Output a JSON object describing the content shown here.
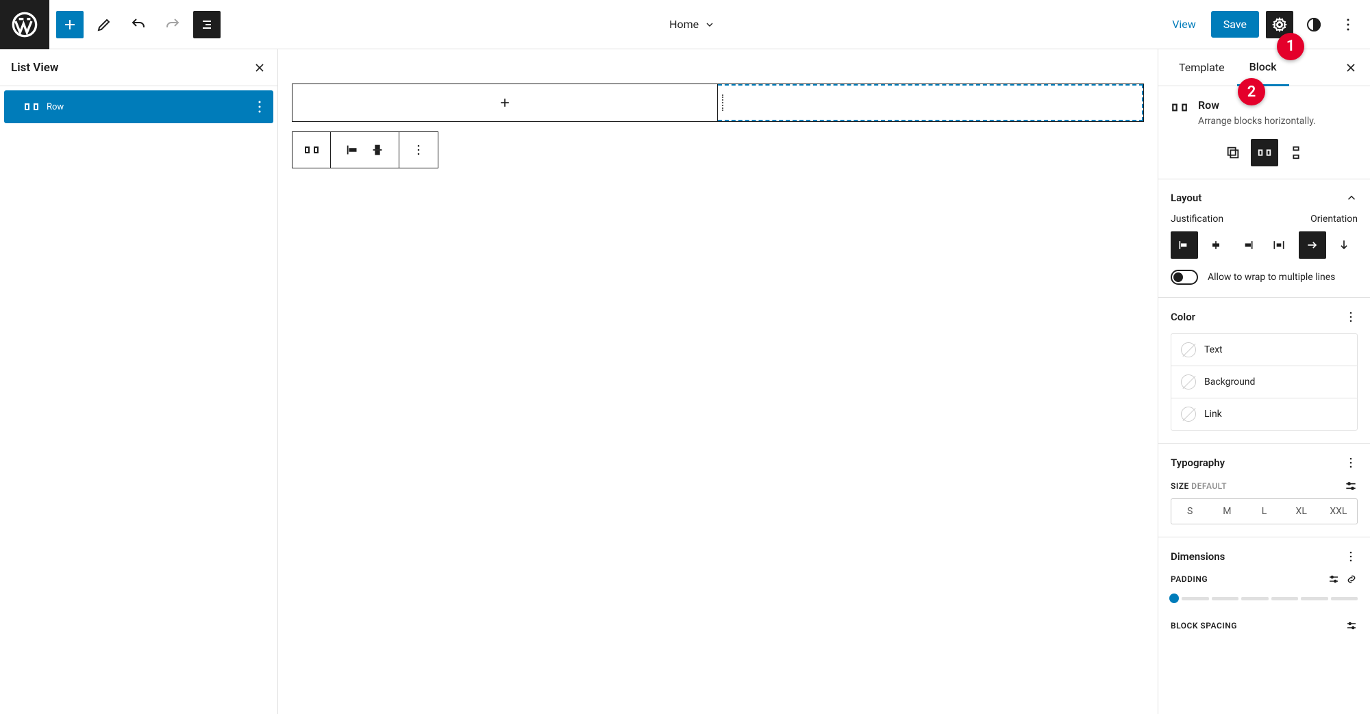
{
  "header": {
    "page_title": "Home",
    "view_label": "View",
    "save_label": "Save"
  },
  "annotations": {
    "badge1": "1",
    "badge2": "2"
  },
  "list_view": {
    "title": "List View",
    "items": [
      {
        "label": "Row"
      }
    ]
  },
  "settings": {
    "tabs": {
      "template": "Template",
      "block": "Block"
    },
    "block": {
      "name": "Row",
      "description": "Arrange blocks horizontally."
    },
    "layout": {
      "title": "Layout",
      "justification_label": "Justification",
      "orientation_label": "Orientation",
      "wrap_label": "Allow to wrap to multiple lines",
      "wrap_enabled": false
    },
    "color": {
      "title": "Color",
      "items": [
        "Text",
        "Background",
        "Link"
      ]
    },
    "typography": {
      "title": "Typography",
      "size_label": "SIZE",
      "size_default": "DEFAULT",
      "sizes": [
        "S",
        "M",
        "L",
        "XL",
        "XXL"
      ]
    },
    "dimensions": {
      "title": "Dimensions",
      "padding_label": "PADDING",
      "block_spacing_label": "BLOCK SPACING"
    }
  }
}
